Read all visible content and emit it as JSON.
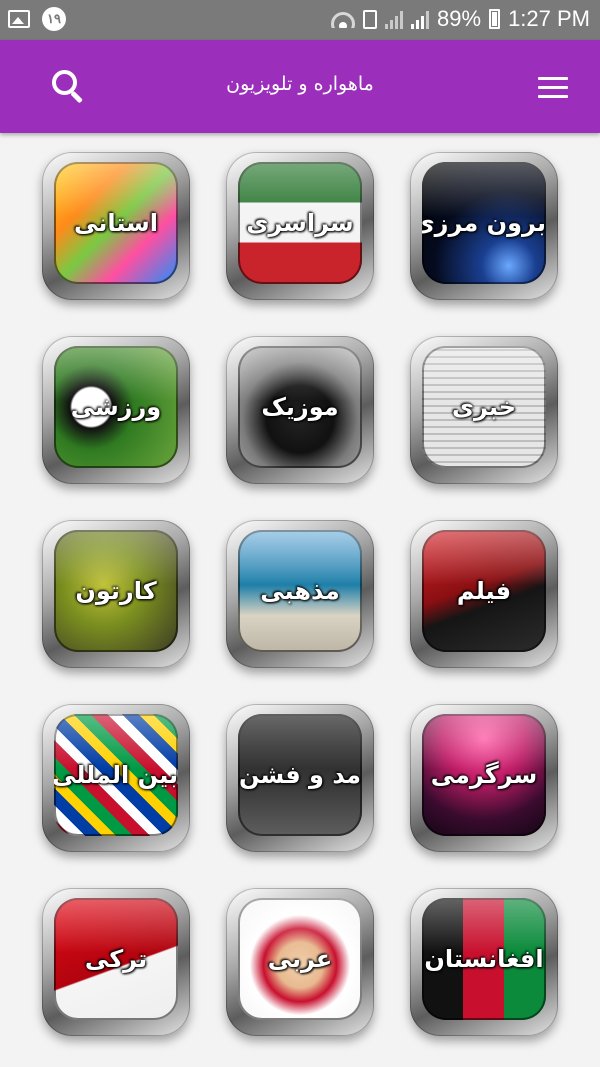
{
  "status_bar": {
    "notification_badge": "١٩",
    "battery": "89%",
    "time": "1:27 PM",
    "icons": [
      "gallery-icon",
      "wifi-icon",
      "sim-icon",
      "signal-icon",
      "battery-icon"
    ]
  },
  "app_bar": {
    "title": "ماهواره و تلویزیون",
    "color": "#9b2ebb",
    "icons": [
      "menu-icon",
      "search-icon"
    ]
  },
  "categories": [
    {
      "label": "برون مرزی"
    },
    {
      "label": "سراسری"
    },
    {
      "label": "استانی"
    },
    {
      "label": "خبری"
    },
    {
      "label": "موزیک"
    },
    {
      "label": "ورزشی"
    },
    {
      "label": "فیلم"
    },
    {
      "label": "مذهبی"
    },
    {
      "label": "کارتون"
    },
    {
      "label": "سرگرمی"
    },
    {
      "label": "مد و فشن"
    },
    {
      "label": "بین المللی"
    },
    {
      "label": "افغانستان"
    },
    {
      "label": "عربی"
    },
    {
      "label": "ترکی"
    }
  ]
}
